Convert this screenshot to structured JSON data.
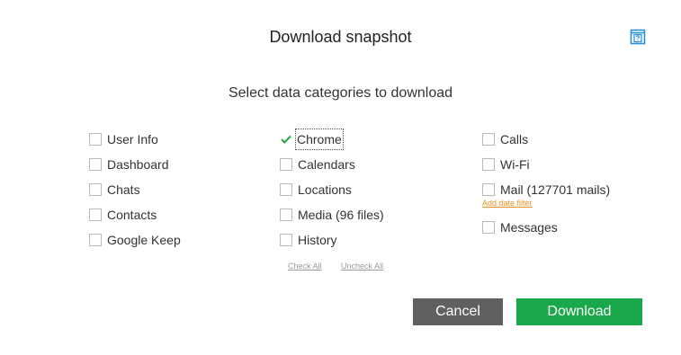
{
  "dialog": {
    "title": "Download snapshot",
    "help_icon": "help-book-icon",
    "subtitle": "Select data categories to download"
  },
  "colors": {
    "accent": "#1aa84a",
    "cancel_bg": "#606060",
    "link_orange": "#e6931f",
    "help_icon": "#2b8fd6"
  },
  "columns": {
    "col1": [
      {
        "label": "User Info",
        "checked": false
      },
      {
        "label": "Dashboard",
        "checked": false
      },
      {
        "label": "Chats",
        "checked": false
      },
      {
        "label": "Contacts",
        "checked": false
      },
      {
        "label": "Google Keep",
        "checked": false
      }
    ],
    "col2": [
      {
        "label": "Chrome",
        "checked": true
      },
      {
        "label": "Calendars",
        "checked": false
      },
      {
        "label": "Locations",
        "checked": false
      },
      {
        "label": "Media (96 files)",
        "checked": false
      },
      {
        "label": "History",
        "checked": false
      }
    ],
    "col3": [
      {
        "label": "Calls",
        "checked": false
      },
      {
        "label": "Wi-Fi",
        "checked": false
      },
      {
        "label": "Mail (127701 mails)",
        "checked": false
      },
      {
        "label": "Messages",
        "checked": false
      }
    ]
  },
  "mail_filter_link": "Add date filter",
  "links": {
    "check_all": "Check All",
    "uncheck_all": "Uncheck All"
  },
  "buttons": {
    "cancel": "Cancel",
    "download": "Download"
  }
}
